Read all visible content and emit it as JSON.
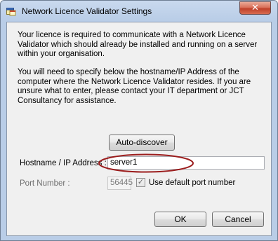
{
  "window": {
    "title": "Network Licence Validator Settings",
    "close_glyph": "✕"
  },
  "intro": {
    "paragraph1": "Your licence is required to communicate with a Network Licence Validator which should already be installed and running on a server within your organisation.",
    "paragraph2": "You will need to specify below the hostname/IP Address of the computer where the Network Licence Validator resides.  If you are unsure what to enter, please contact your IT department or JCT Consultancy for assistance."
  },
  "buttons": {
    "autodiscover": "Auto-discover",
    "ok": "OK",
    "cancel": "Cancel"
  },
  "hostname": {
    "label": "Hostname / IP Address :",
    "value": "server1"
  },
  "port": {
    "label": "Port Number :",
    "value": "56445",
    "enabled": false
  },
  "default_port": {
    "label": "Use default port number",
    "checked": true,
    "check_glyph": "✓"
  },
  "colors": {
    "highlight_ellipse": "#9b1c1c",
    "titlebar": "#b9cde7",
    "close_button": "#c0412a"
  },
  "icons": {
    "app": "app-window-icon",
    "close": "close-icon"
  }
}
